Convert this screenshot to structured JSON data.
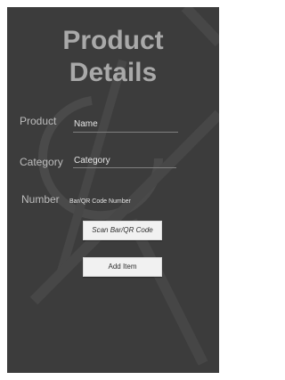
{
  "header": {
    "title_line1": "Product",
    "title_line2": "Details"
  },
  "form": {
    "product": {
      "label": "Product",
      "value": "Name"
    },
    "category": {
      "label": "Category",
      "value": "Category"
    },
    "number": {
      "label": "Number",
      "value": "Bar/QR Code Number"
    }
  },
  "buttons": {
    "scan_label": "Scan Bar/QR Code",
    "add_label": "Add Item"
  },
  "colors": {
    "background": "#3c3c3c",
    "title": "#a9a9a9",
    "button": "#f1f1f1"
  }
}
